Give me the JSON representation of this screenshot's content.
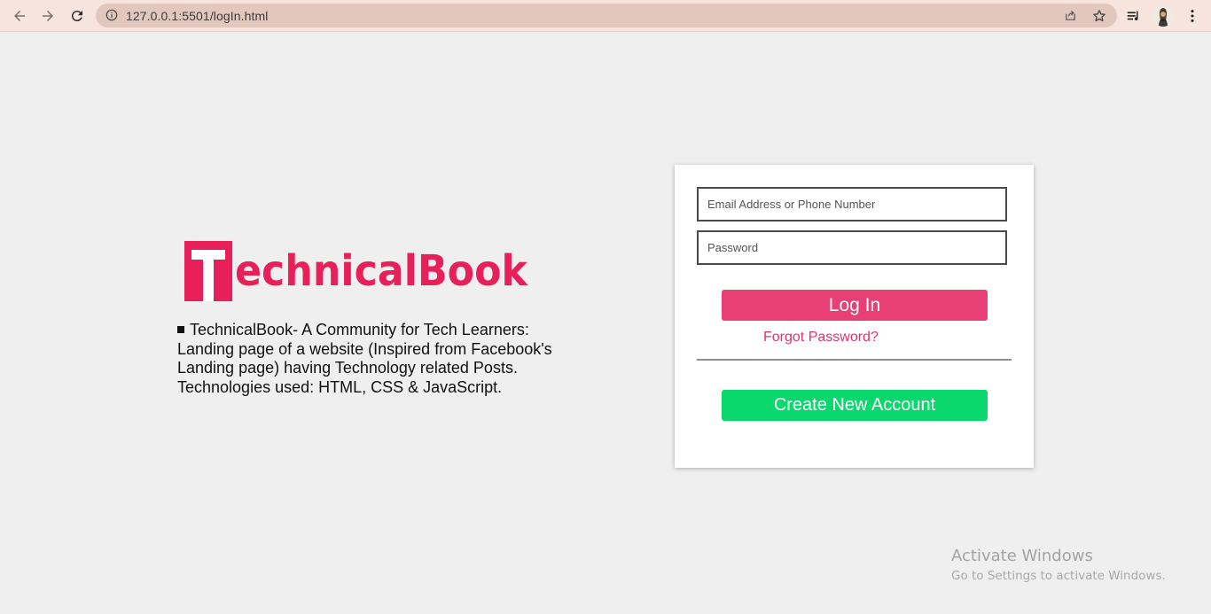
{
  "browser": {
    "url": "127.0.0.1:5501/logIn.html",
    "icons": [
      "back-arrow-icon",
      "forward-arrow-icon",
      "reload-icon",
      "site-info-icon",
      "share-icon",
      "bookmark-star-icon",
      "reading-list-icon",
      "profile-avatar",
      "more-vert-icon"
    ]
  },
  "brand": {
    "logo_text": "TechnicalBook",
    "logo_color": "#e8205a"
  },
  "description": {
    "lines": [
      "TechnicalBook- A Community for Tech Learners:",
      "Landing page of a website (Inspired from Facebook's",
      "Landing page) having Technology related Posts.",
      "Technologies used: HTML, CSS & JavaScript."
    ]
  },
  "login_form": {
    "email_placeholder": "Email Address or Phone Number",
    "email_value": "",
    "password_placeholder": "Password",
    "password_value": "",
    "login_label": "Log In",
    "forgot_label": "Forgot Password?",
    "create_label": "Create New Account",
    "colors": {
      "login": "#e83f76",
      "forgot": "#e2346c",
      "create": "#0bd86c"
    }
  },
  "watermark": {
    "title": "Activate Windows",
    "subtitle": "Go to Settings to activate Windows."
  }
}
